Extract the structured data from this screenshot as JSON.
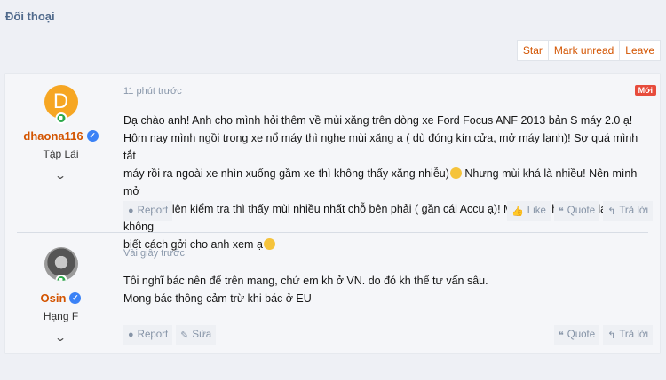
{
  "page": {
    "title": "Đối thoại"
  },
  "actions": {
    "star": "Star",
    "mark_unread": "Mark unread",
    "leave": "Leave"
  },
  "messages": [
    {
      "user": {
        "avatar_letter": "D",
        "name": "dhaona116",
        "title": "Tập Lái"
      },
      "time": "11 phút trước",
      "badge": "Mới",
      "lines": [
        "Dạ chào anh! Anh cho mình hỏi thêm về mùi xăng trên dòng xe Ford Focus ANF 2013 bản S máy 2.0 ạ!",
        "Hôm nay mình ngồi trong xe nổ máy thì nghe mùi xăng ạ ( dù đóng kín cửa, mở máy lạnh)! Sợ quá mình tắt",
        "máy rồi ra ngoài xe nhìn xuống gầm xe thì không thấy xăng nhiễu)",
        " Nhưng mùi khá là nhiều! Nên mình mở",
        "nắp capo lên kiểm tra thì thấy mùi nhiều nhất chỗ bên phải ( gần cái Accu ạ)! Mình có chụp hình lại mà không",
        "biết cách gởi cho anh xem ạ"
      ],
      "footer": {
        "report": "Report",
        "like": "Like",
        "quote": "Quote",
        "reply": "Trả lời"
      }
    },
    {
      "user": {
        "name": "Osin",
        "title": "Hạng F"
      },
      "time": "Vài giây trước",
      "lines": [
        "Tôi nghĩ bác nên để trên mang, chứ em kh ở VN. do đó kh thể tư vấn sâu.",
        "Mong bác thông cảm trừ khi bác ở EU"
      ],
      "footer": {
        "report": "Report",
        "edit": "Sửa",
        "quote": "Quote",
        "reply": "Trả lời"
      }
    }
  ],
  "icons": {
    "verified": "verified-badge-icon",
    "online": "online-status-icon",
    "chevron": "chevron-down-icon",
    "report": "info-circle-icon",
    "like": "thumbs-up-icon",
    "quote": "quote-icon",
    "reply": "reply-arrow-icon",
    "edit": "pencil-icon"
  },
  "colors": {
    "accent": "#d35400",
    "badge": "#e74c3c",
    "title": "#506a8c",
    "muted": "#8593a6"
  }
}
